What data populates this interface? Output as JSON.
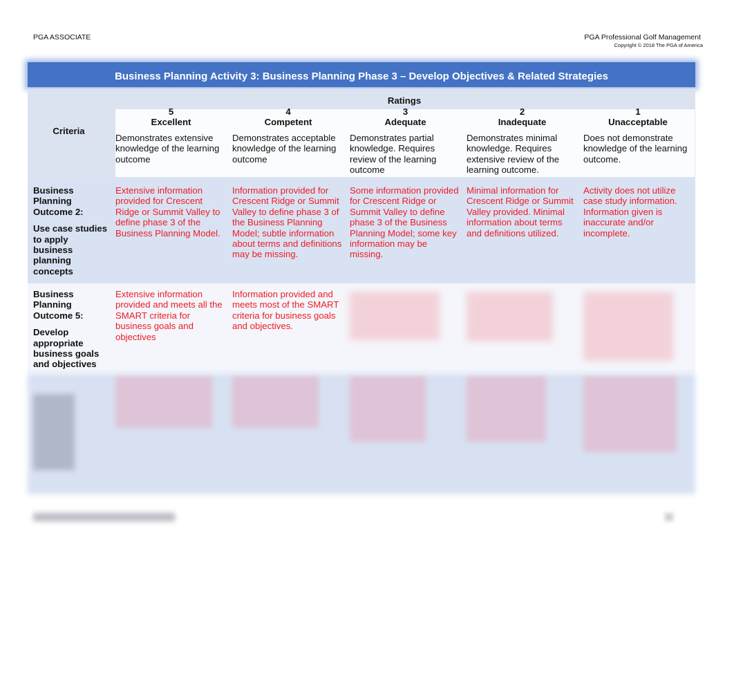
{
  "page_header": {
    "left": "PGA ASSOCIATE",
    "right_title": "PGA Professional Golf Management",
    "copyright": "Copyright © 2018 The PGA of America"
  },
  "title": "Business Planning Activity 3: Business Planning Phase 3 – Develop Objectives & Related Strategies",
  "colors": {
    "title_bar": "#4472c4",
    "rubric_text": "#ee1c25",
    "row_tint": "#d9e2f2"
  },
  "rubric": {
    "criteria_label": "Criteria",
    "ratings_label": "Ratings",
    "levels": [
      {
        "score": "5",
        "name": "Excellent",
        "description": "Demonstrates extensive knowledge of the learning outcome"
      },
      {
        "score": "4",
        "name": "Competent",
        "description": "Demonstrates acceptable knowledge of the learning outcome"
      },
      {
        "score": "3",
        "name": "Adequate",
        "description": "Demonstrates partial knowledge. Requires review of the learning outcome"
      },
      {
        "score": "2",
        "name": "Inadequate",
        "description": "Demonstrates minimal knowledge. Requires extensive review of the learning outcome."
      },
      {
        "score": "1",
        "name": "Unacceptable",
        "description": "Does not demonstrate knowledge of the learning outcome."
      }
    ],
    "rows": [
      {
        "outcome": "Business Planning Outcome 2:",
        "detail": "Use case studies to apply business planning concepts",
        "cells": [
          "Extensive information provided for Crescent Ridge or Summit Valley to define phase 3 of the Business Planning Model.",
          "Information provided for Crescent Ridge or Summit Valley to define phase 3 of the Business Planning Model; subtle information about terms and definitions may be missing.",
          "Some information provided for Crescent Ridge or Summit Valley to define phase 3 of the Business Planning Model; some key information may be missing.",
          "Minimal information for Crescent Ridge or Summit Valley provided. Minimal information about terms and definitions utilized.",
          "Activity does not utilize case study information. Information given is inaccurate and/or incomplete."
        ]
      },
      {
        "outcome": "Business Planning Outcome 5:",
        "detail": "Develop appropriate business goals and objectives",
        "cells": [
          "Extensive information provided and meets all the SMART criteria for business goals and objectives",
          "Information provided and meets most of the SMART criteria for business goals and objectives."
        ]
      }
    ]
  }
}
